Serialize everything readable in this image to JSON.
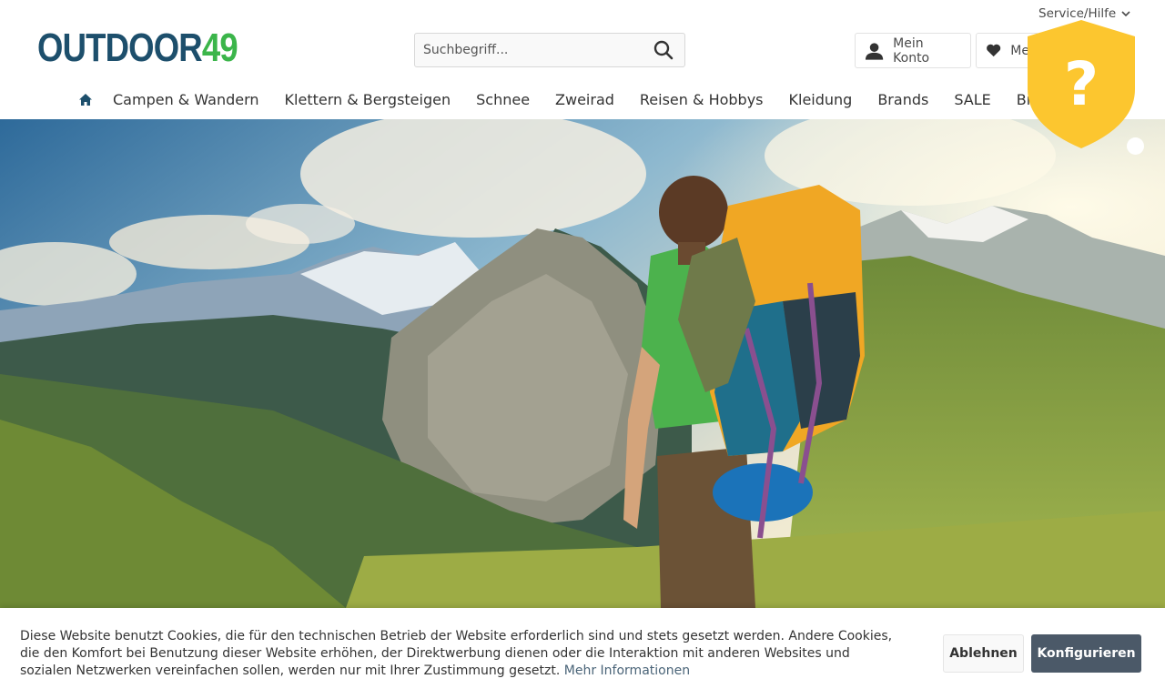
{
  "header": {
    "logo_part1": "OUTDOOR",
    "logo_part2": "49",
    "service_label": "Service/Hilfe",
    "search_placeholder": "Suchbegriff...",
    "account_label": "Mein Konto",
    "wishlist_label": "Me"
  },
  "nav": {
    "items": [
      {
        "label": "Campen & Wandern"
      },
      {
        "label": "Klettern & Bergsteigen"
      },
      {
        "label": "Schnee"
      },
      {
        "label": "Zweirad"
      },
      {
        "label": "Reisen & Hobbys"
      },
      {
        "label": "Kleidung"
      },
      {
        "label": "Brands"
      },
      {
        "label": "SALE"
      },
      {
        "label": "Brands IT"
      }
    ]
  },
  "badge": {
    "glyph": "?",
    "color": "#fcc62f"
  },
  "cookie": {
    "text": "Diese Website benutzt Cookies, die für den technischen Betrieb der Website erforderlich sind und stets gesetzt werden. Andere Cookies, die den Komfort bei Benutzung dieser Website erhöhen, der Direktwerbung dienen oder die Interaktion mit anderen Websites und sozialen Netzwerken vereinfachen sollen, werden nur mit Ihrer Zustimmung gesetzt.",
    "more_link": "Mehr Informationen",
    "deny_label": "Ablehnen",
    "configure_label": "Konfigurieren"
  },
  "colors": {
    "logo_blue": "#1d4f6c",
    "logo_green": "#3bb54a",
    "configure_button": "#4b5968"
  }
}
